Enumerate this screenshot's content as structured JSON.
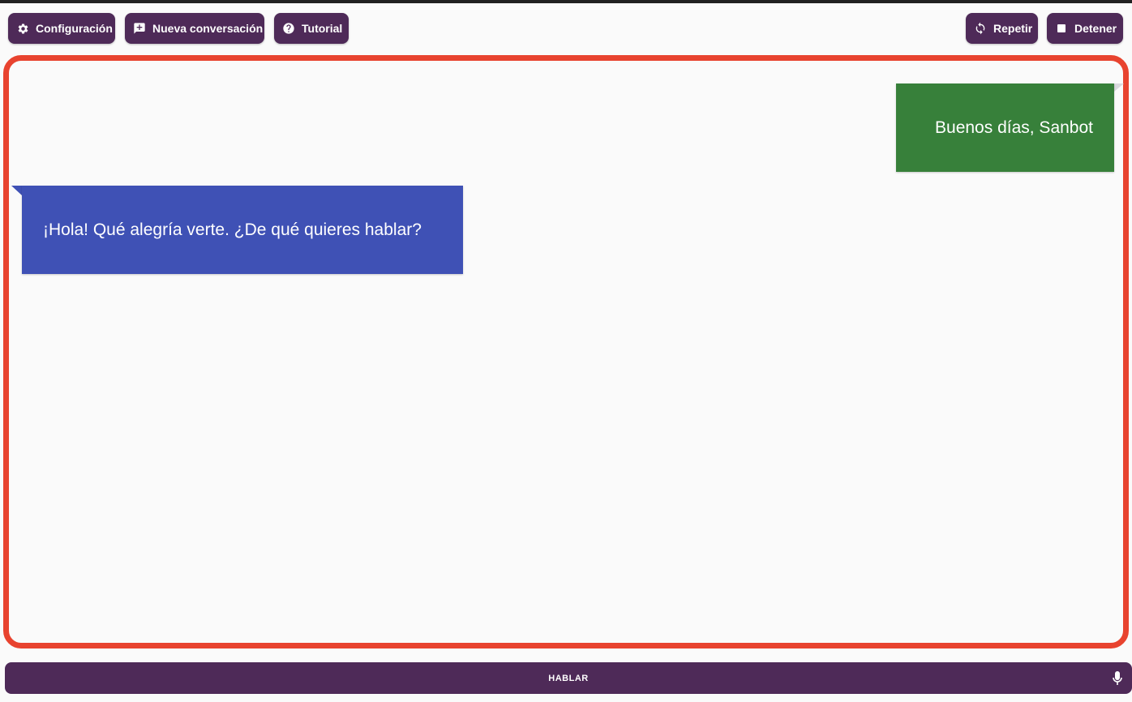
{
  "toolbar": {
    "config_label": "Configuración",
    "config_icon": "gear-icon",
    "new_conversation_label": "Nueva conversación",
    "new_conversation_icon": "add-comment-icon",
    "tutorial_label": "Tutorial",
    "tutorial_icon": "help-circle-icon",
    "repeat_label": "Repetir",
    "repeat_icon": "sync-icon",
    "stop_label": "Detener",
    "stop_icon": "stop-icon"
  },
  "chat": {
    "messages": [
      {
        "sender": "user",
        "text": "Buenos días, Sanbot",
        "color": "#37803a"
      },
      {
        "sender": "bot",
        "text": "¡Hola! Qué alegría verte. ¿De qué quieres hablar?",
        "color": "#3f51b5"
      }
    ],
    "frame_color": "#e8432f"
  },
  "speak": {
    "label": "HABLAR",
    "icon": "microphone-icon"
  },
  "colors": {
    "button_bg": "#4e2a58",
    "background": "#fafafa"
  }
}
